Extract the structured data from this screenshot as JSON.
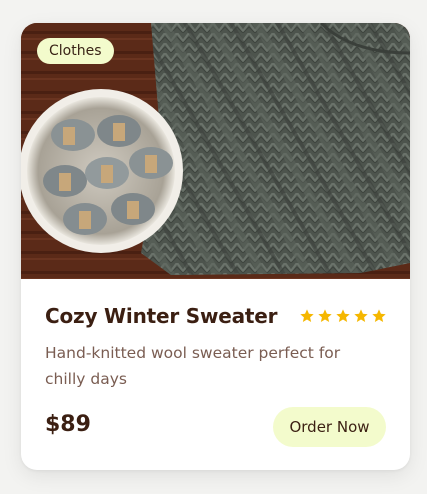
{
  "product": {
    "category": "Clothes",
    "title": "Cozy Winter Sweater",
    "description": "Hand-knitted wool sweater perfect for chilly days",
    "price": "$89",
    "rating": 5,
    "rating_max": 5,
    "image": "knitted-sweater-photo",
    "order_label": "Order Now"
  },
  "colors": {
    "badge_bg": "#f3fbcc",
    "button_bg": "#f3fbcc",
    "star": "#f5b700",
    "title": "#3b1f12",
    "description": "#7a5d52"
  }
}
